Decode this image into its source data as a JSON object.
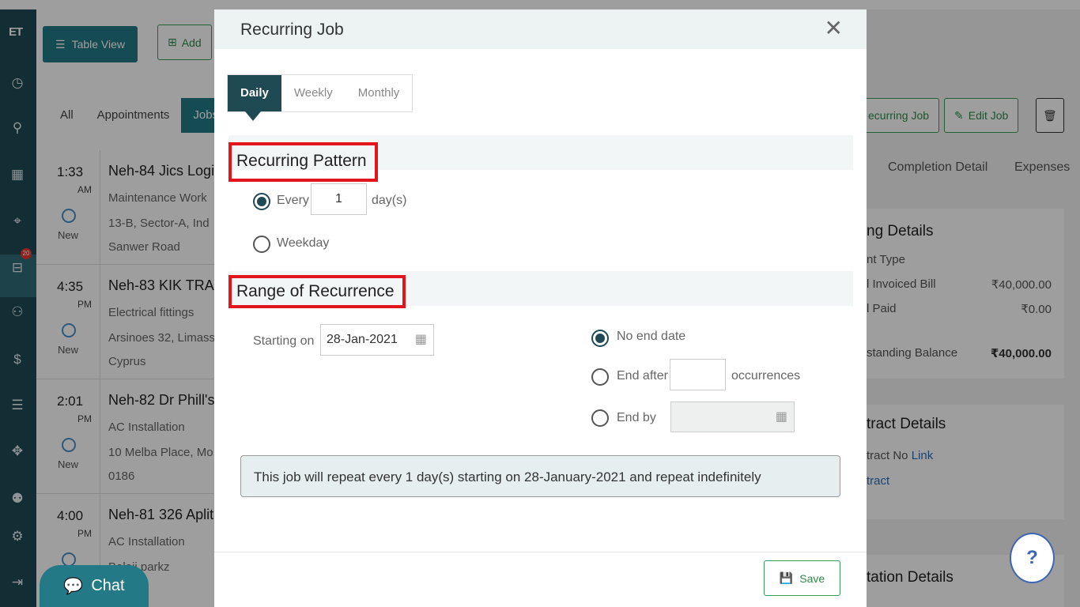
{
  "rail": {
    "logo": "ET",
    "icons": [
      "dashboard-icon",
      "pipeline-icon",
      "calendar-icon",
      "map-icon",
      "jobs-icon",
      "person-icon",
      "invoice-icon",
      "list-icon",
      "handshake-icon",
      "team-icon",
      "settings-icon",
      "logout-icon"
    ],
    "badge": "20"
  },
  "background": {
    "table_view_label": "Table View",
    "add_label": "Add",
    "tabs": [
      "All",
      "Appointments",
      "Jobs"
    ],
    "jobs": [
      {
        "time": "1:33",
        "ampm": "AM",
        "status": "New",
        "title": "Neh-84 Jics Logi",
        "line1": "Maintenance Work",
        "line2": "13-B, Sector-A, Ind",
        "line3": "Sanwer Road"
      },
      {
        "time": "4:35",
        "ampm": "PM",
        "status": "New",
        "title": "Neh-83 KIK TRA",
        "line1": "Electrical fittings",
        "line2": "Arsinoes 32, Limass",
        "line3": "Cyprus"
      },
      {
        "time": "2:01",
        "ampm": "PM",
        "status": "New",
        "title": "Neh-82 Dr Phill's",
        "line1": "AC Installation",
        "line2": "10 Melba Place, Mo",
        "line3": "0186"
      },
      {
        "time": "4:00",
        "ampm": "PM",
        "status": "",
        "title": "Neh-81 326 Aplit",
        "line1": "AC Installation",
        "line2": "Balaji parkz",
        "line3": ""
      }
    ],
    "recurring_job_label": "ecurring Job",
    "edit_job_label": "Edit Job",
    "right_tabs": [
      "Completion Detail",
      "Expenses"
    ],
    "billing": {
      "heading": "ng Details",
      "rows": [
        {
          "label": "nt Type",
          "value": ""
        },
        {
          "label": "l Invoiced Bill",
          "value": "₹40,000.00"
        },
        {
          "label": "l Paid",
          "value": "₹0.00"
        },
        {
          "label": "standing Balance",
          "value": "₹40,000.00"
        }
      ]
    },
    "contract": {
      "heading": "tract Details",
      "no_label": "tract No",
      "no_link": "Link",
      "link2": "tract"
    },
    "quotation_heading": "tation Details"
  },
  "modal": {
    "title": "Recurring Job",
    "close": "✕",
    "frequency_tabs": [
      "Daily",
      "Weekly",
      "Monthly"
    ],
    "recurring_pattern": {
      "heading": "Recurring Pattern",
      "every_label": "Every",
      "every_value": "1",
      "unit": "day(s)",
      "weekday_label": "Weekday"
    },
    "range": {
      "heading": "Range of Recurrence",
      "starting_label": "Starting on",
      "starting_value": "28-Jan-2021",
      "no_end_label": "No end date",
      "end_after_label": "End after",
      "end_after_value": "",
      "occurrences_label": "occurrences",
      "end_by_label": "End by",
      "end_by_value": ""
    },
    "summary": "This job will repeat every 1 day(s) starting on 28-January-2021 and repeat indefinitely",
    "save_label": "Save"
  },
  "chat_label": "Chat",
  "help_label": "?"
}
